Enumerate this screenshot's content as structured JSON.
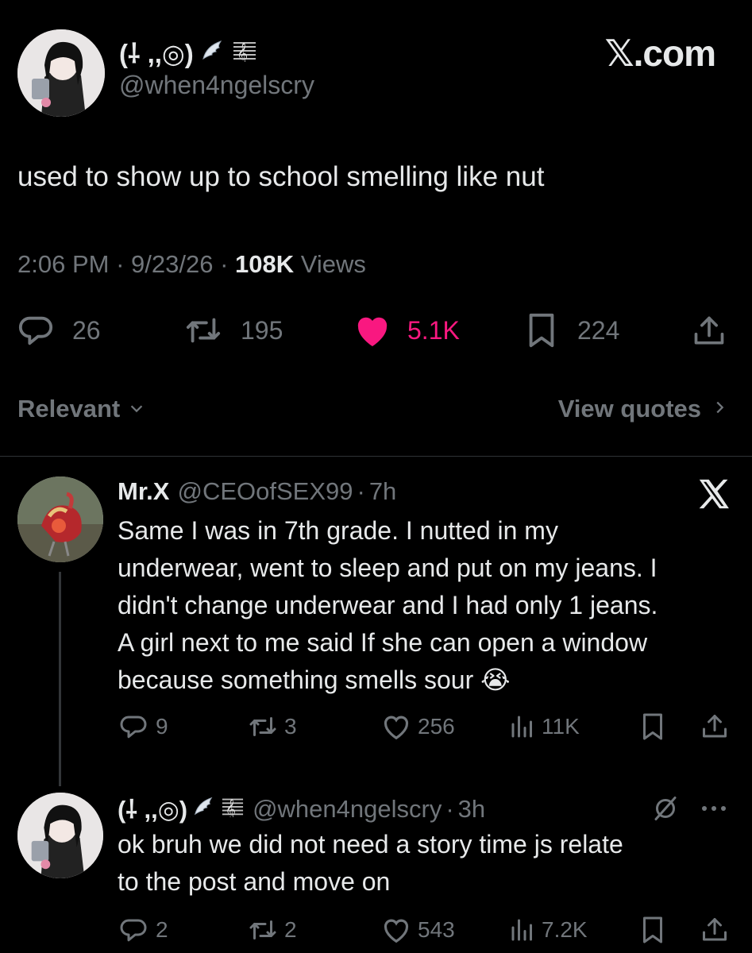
{
  "brand": "𝕏.com",
  "post": {
    "display_name": "(⸸ ,,◎)",
    "handle": "@when4ngelscry",
    "text": "used to show up to school smelling like nut",
    "time": "2:06 PM",
    "date": "9/23/26",
    "views_count": "108K",
    "views_label": "Views",
    "replies": "26",
    "reposts": "195",
    "likes": "5.1K",
    "bookmarks": "224"
  },
  "sort_label": "Relevant",
  "view_quotes_label": "View quotes",
  "replies": [
    {
      "display_name": "Mr.X",
      "handle": "@CEOofSEX99",
      "time": "7h",
      "lines": [
        "Same I was in 7th grade. I nutted in my",
        "underwear, went to sleep and put on my jeans. I",
        "didn't change underwear and I had only 1 jeans.",
        "A girl next to me said If she can open a window",
        "because something smells sour 😭"
      ],
      "replies": "9",
      "reposts": "3",
      "likes": "256",
      "views": "11K"
    },
    {
      "display_name": "(⸸ ,,◎)",
      "handle": "@when4ngelscry",
      "time": "3h",
      "lines": [
        "ok bruh we did not need a story time js relate",
        "to the post and move on"
      ],
      "replies": "2",
      "reposts": "2",
      "likes": "543",
      "views": "7.2K"
    }
  ],
  "colors": {
    "background": "#000000",
    "text": "#e7e9ea",
    "muted": "#71767b",
    "like": "#f91880",
    "divider": "#2f3336"
  }
}
